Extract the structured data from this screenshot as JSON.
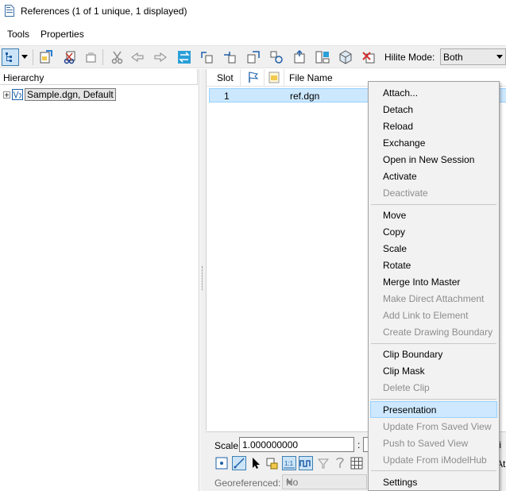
{
  "window": {
    "title": "References (1 of 1 unique, 1 displayed)"
  },
  "menubar": {
    "tools": "Tools",
    "properties": "Properties"
  },
  "toolbar": {
    "hilite_label": "Hilite Mode:",
    "hilite_value": "Both"
  },
  "hierarchy": {
    "header": "Hierarchy",
    "root_item": "Sample.dgn, Default"
  },
  "table": {
    "columns": {
      "slot": "Slot",
      "file_name": "File Name"
    },
    "rows": [
      {
        "slot": "1",
        "file_name": "ref.dgn"
      }
    ]
  },
  "bottom": {
    "scale_label": "Scale",
    "scale_value": "1.000000000",
    "scale_colon": ":",
    "georef_label": "Georeferenced:",
    "georef_value": "No",
    "cut_text_1": "ti",
    "cut_text_2": "At"
  },
  "context_menu": {
    "attach": "Attach...",
    "detach": "Detach",
    "reload": "Reload",
    "exchange": "Exchange",
    "open_new_session": "Open in New Session",
    "activate": "Activate",
    "deactivate": "Deactivate",
    "move": "Move",
    "copy": "Copy",
    "scale": "Scale",
    "rotate": "Rotate",
    "merge_into_master": "Merge Into Master",
    "make_direct_attachment": "Make Direct Attachment",
    "add_link_to_element": "Add Link to Element",
    "create_drawing_boundary": "Create Drawing Boundary",
    "clip_boundary": "Clip Boundary",
    "clip_mask": "Clip Mask",
    "delete_clip": "Delete Clip",
    "presentation": "Presentation",
    "update_from_saved_view": "Update From Saved View",
    "push_to_saved_view": "Push to Saved View",
    "update_from_imodelhub": "Update From iModelHub",
    "settings": "Settings"
  }
}
